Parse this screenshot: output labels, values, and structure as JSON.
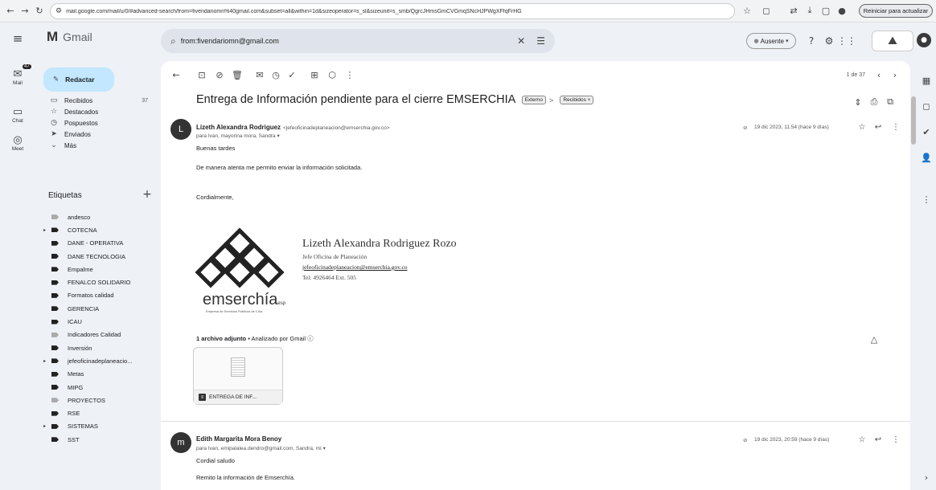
{
  "browser": {
    "url": "mail.google.com/mail/u/0/#advanced-search/from=fivendariomn%40gmail.com&subset=all&within=1d&sizeoperator=s_sl&sizeunit=s_smb/QgrcJHmsGmCVGmqSNcHJPWgXFfqFrHG",
    "update_label": "Reiniciar para actualizar"
  },
  "rail": {
    "mail_label": "Mail",
    "mail_badge": "47",
    "chat_label": "Chat",
    "meet_label": "Meet"
  },
  "header": {
    "brand": "Gmail",
    "search_value": "from:fivendariomn@gmail.com",
    "status_label": "Ausente"
  },
  "sidebar": {
    "compose_label": "Redactar",
    "items": [
      {
        "icon": "inbox-icon",
        "glyph": "▭",
        "label": "Recibidos",
        "count": "37"
      },
      {
        "icon": "star-icon",
        "glyph": "☆",
        "label": "Destacados",
        "count": ""
      },
      {
        "icon": "clock-icon",
        "glyph": "◷",
        "label": "Pospuestos",
        "count": ""
      },
      {
        "icon": "send-icon",
        "glyph": "➤",
        "label": "Enviados",
        "count": ""
      },
      {
        "icon": "chevron-down-icon",
        "glyph": "⌄",
        "label": "Más",
        "count": ""
      }
    ],
    "labels_title": "Etiquetas",
    "labels": [
      {
        "label": "andesco",
        "light": true,
        "caret": false
      },
      {
        "label": "COTECNA",
        "light": false,
        "caret": true
      },
      {
        "label": "DANE - OPERATIVA",
        "light": false,
        "caret": false
      },
      {
        "label": "DANE TECNOLOGIA",
        "light": false,
        "caret": false
      },
      {
        "label": "Empalme",
        "light": false,
        "caret": false
      },
      {
        "label": "FENALCO SOLIDARIO",
        "light": false,
        "caret": false
      },
      {
        "label": "Formatos calidad",
        "light": false,
        "caret": false
      },
      {
        "label": "GERENCIA",
        "light": false,
        "caret": false
      },
      {
        "label": "ICAU",
        "light": false,
        "caret": false
      },
      {
        "label": "Indicadores Calidad",
        "light": true,
        "caret": false
      },
      {
        "label": "Inversión",
        "light": false,
        "caret": false
      },
      {
        "label": "jefeoficinadeplaneacio...",
        "light": false,
        "caret": true
      },
      {
        "label": "Metas",
        "light": false,
        "caret": false
      },
      {
        "label": "MIPG",
        "light": false,
        "caret": false
      },
      {
        "label": "PROYECTOS",
        "light": true,
        "caret": false
      },
      {
        "label": "RSE",
        "light": false,
        "caret": false
      },
      {
        "label": "SISTEMAS",
        "light": false,
        "caret": true
      },
      {
        "label": "SST",
        "light": false,
        "caret": false
      }
    ]
  },
  "pane": {
    "pager": "1 de 37",
    "subject": "Entrega de Información pendiente para el cierre EMSERCHIA",
    "chip_external": "Externo",
    "chip_inbox": "Recibidos ×"
  },
  "message1": {
    "avatar_letter": "L",
    "sender": "Lizeth Alexandra Rodriguez",
    "email": "<jefeoficinadeplaneacion@emserchia.gov.co>",
    "recipients": "para Ivan, mayorina mora, Sandra ▾",
    "date": "19 dic 2023, 11:54 (hace 9 días)",
    "greeting": "Buenas tardes",
    "body": "De manera atenta me permito enviar la información solicitada.",
    "closing": "Cordialmente,",
    "sig_name": "Lizeth Alexandra Rodriguez Rozo",
    "sig_title": "Jefe Oficina de Planeación",
    "sig_email": "jefeoficinadeplaneacion@emserchia.gov.co",
    "sig_phone": "Tel: 4926464 Ext. 505",
    "brand_text": "emserchía",
    "brand_suffix": "esp",
    "brand_tagline": "Empresa de Servicios Públicos de Chía",
    "attach_count": "1 archivo adjunto",
    "attach_scan": " • Analizado por Gmail ⓘ",
    "attach_name": "ENTREGA DE INF..."
  },
  "message2": {
    "avatar_letter": "m",
    "sender": "Edith Margarita Mora Benoy",
    "recipients": "para Ivan, emipalalea.dendro@gmail.com, Sandra, mí ▾",
    "date": "19 dic 2023, 20:59 (hace 9 días)",
    "greeting": "Cordial saludo",
    "body": "Remito la información de Emserchía."
  }
}
